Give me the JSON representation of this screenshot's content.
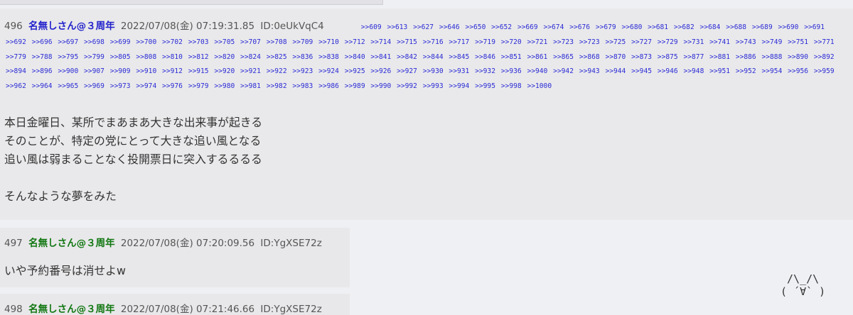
{
  "theme": {
    "name_color": "#117711",
    "name_color_496": "#2222cc",
    "link_color": "#2b2bd6",
    "page_bg": "#eff0f4",
    "post_bg": "#e8e8ea"
  },
  "posts": [
    {
      "number": "496",
      "name": "名無しさん@３周年",
      "date": "2022/07/08(金) 07:19:31.85",
      "id": "ID:0eUkVqC4",
      "replies": [
        ">>609",
        ">>613",
        ">>627",
        ">>646",
        ">>650",
        ">>652",
        ">>669",
        ">>674",
        ">>676",
        ">>679",
        ">>680",
        ">>681",
        ">>682",
        ">>684",
        ">>688",
        ">>689",
        ">>690",
        ">>691",
        ">>692",
        ">>696",
        ">>697",
        ">>698",
        ">>699",
        ">>700",
        ">>702",
        ">>703",
        ">>705",
        ">>707",
        ">>708",
        ">>709",
        ">>710",
        ">>712",
        ">>714",
        ">>715",
        ">>716",
        ">>717",
        ">>719",
        ">>720",
        ">>721",
        ">>723",
        ">>723",
        ">>725",
        ">>727",
        ">>729",
        ">>731",
        ">>741",
        ">>743",
        ">>749",
        ">>751",
        ">>771",
        ">>779",
        ">>788",
        ">>795",
        ">>799",
        ">>805",
        ">>808",
        ">>810",
        ">>812",
        ">>820",
        ">>824",
        ">>825",
        ">>836",
        ">>838",
        ">>840",
        ">>841",
        ">>842",
        ">>844",
        ">>845",
        ">>846",
        ">>851",
        ">>861",
        ">>865",
        ">>868",
        ">>870",
        ">>873",
        ">>875",
        ">>877",
        ">>881",
        ">>886",
        ">>888",
        ">>890",
        ">>892",
        ">>894",
        ">>896",
        ">>900",
        ">>907",
        ">>909",
        ">>910",
        ">>912",
        ">>915",
        ">>920",
        ">>921",
        ">>922",
        ">>923",
        ">>924",
        ">>925",
        ">>926",
        ">>927",
        ">>930",
        ">>931",
        ">>932",
        ">>936",
        ">>940",
        ">>942",
        ">>943",
        ">>944",
        ">>945",
        ">>946",
        ">>948",
        ">>951",
        ">>952",
        ">>954",
        ">>956",
        ">>959",
        ">>962",
        ">>964",
        ">>965",
        ">>969",
        ">>973",
        ">>974",
        ">>976",
        ">>979",
        ">>980",
        ">>981",
        ">>982",
        ">>983",
        ">>986",
        ">>989",
        ">>990",
        ">>992",
        ">>993",
        ">>994",
        ">>995",
        ">>998",
        ">>1000"
      ],
      "body": [
        "本日金曜日、某所でまあまあ大きな出来事が起きる",
        "そのことが、特定の党にとって大きな追い風となる",
        "追い風は弱まることなく投開票日に突入するるるる",
        "",
        "そんなような夢をみた"
      ]
    },
    {
      "number": "497",
      "name": "名無しさん@３周年",
      "date": "2022/07/08(金) 07:20:09.56",
      "id": "ID:YgXSE72z",
      "body": [
        "いや予約番号は消せよw"
      ]
    },
    {
      "number": "498",
      "name": "名無しさん@３周年",
      "date": "2022/07/08(金) 07:21:46.66",
      "id": "ID:YgXSE72z"
    }
  ],
  "decoration": {
    "cat_art": " /\\_/\\\n( ´∀` )"
  }
}
